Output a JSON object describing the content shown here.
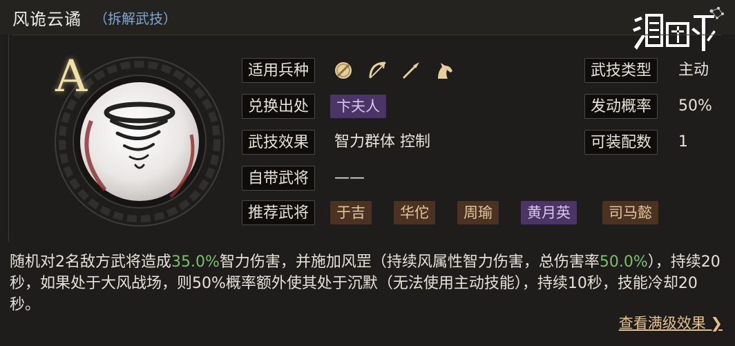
{
  "header": {
    "title": "风诡云谲",
    "subtitle": "（拆解武技）",
    "logo_text": "鸿图之下"
  },
  "grade": "A",
  "rows": {
    "troops_label": "适用兵种",
    "troop_icons": [
      "shield-icon",
      "bow-icon",
      "spear-icon",
      "horse-icon"
    ],
    "source_label": "兑换出处",
    "source_value": "卞夫人",
    "effect_label": "武技效果",
    "effect_value": "智力群体 控制",
    "own_label": "自带武将",
    "own_value": "——",
    "rec_label": "推荐武将",
    "recommended": [
      "于吉",
      "华佗",
      "周瑜",
      "黄月英",
      "司马懿"
    ],
    "type_label": "武技类型",
    "type_value": "主动",
    "prob_label": "发动概率",
    "prob_value": "50%",
    "equip_label": "可装配数",
    "equip_value": "1"
  },
  "description": {
    "p1": "随机对2名敌方武将造成",
    "v1": "35.0%",
    "p2": "智力伤害，并施加风罡（持续风属性智力伤害，总伤害率",
    "v2": "50.0%",
    "p3": "），持续20秒，如果处于大风战场，则50%概率额外使其处于沉默（无法使用主动技能），持续10秒，技能冷却20秒。"
  },
  "more_link": "查看满级效果",
  "colors": {
    "highlight": "#7dbf6a",
    "purple_tag": "#4b3466",
    "brown_tag": "#4a3322",
    "link": "#e5c28a"
  }
}
